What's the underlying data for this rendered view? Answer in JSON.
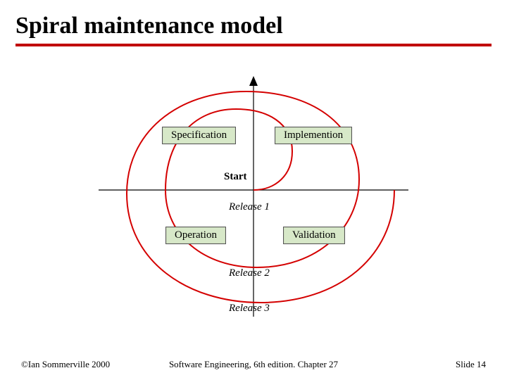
{
  "title": "Spiral maintenance model",
  "diagram": {
    "center_label": "Start",
    "quadrants": {
      "top_left": "Specification",
      "top_right": "Implemention",
      "bottom_left": "Operation",
      "bottom_right": "Validation"
    },
    "releases": [
      "Release 1",
      "Release 2",
      "Release 3"
    ],
    "colors": {
      "spiral": "#d40000",
      "box_fill": "#d7e8c8",
      "box_border": "#555555",
      "axis": "#000000"
    }
  },
  "footer": {
    "left": "©Ian Sommerville 2000",
    "center": "Software Engineering, 6th edition. Chapter 27",
    "right": "Slide 14"
  }
}
